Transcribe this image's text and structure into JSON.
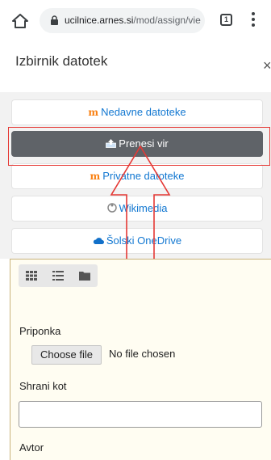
{
  "browser": {
    "url_domain": "ucilnice.arnes.si",
    "url_path": "/mod/assign/vie",
    "tab_count": "1"
  },
  "picker": {
    "title": "Izbirnik datotek",
    "close_glyph": "×"
  },
  "repositories": [
    {
      "label": "Nedavne datoteke",
      "icon": "moodle-icon"
    },
    {
      "label": "Prenesi vir",
      "icon": "upload-icon",
      "active": true
    },
    {
      "label": "Privatne datoteke",
      "icon": "moodle-icon"
    },
    {
      "label": "Wikimedia",
      "icon": "wikimedia-icon"
    },
    {
      "label": "Šolski OneDrive",
      "icon": "cloud-icon"
    }
  ],
  "upload_form": {
    "attachment_label": "Priponka",
    "choose_file_label": "Choose file",
    "no_file_text": "No file chosen",
    "save_as_label": "Shrani kot",
    "save_as_value": "",
    "author_label": "Avtor"
  },
  "colors": {
    "active_repo_bg": "#5f6368",
    "link": "#1177d1",
    "highlight": "#e53935"
  }
}
